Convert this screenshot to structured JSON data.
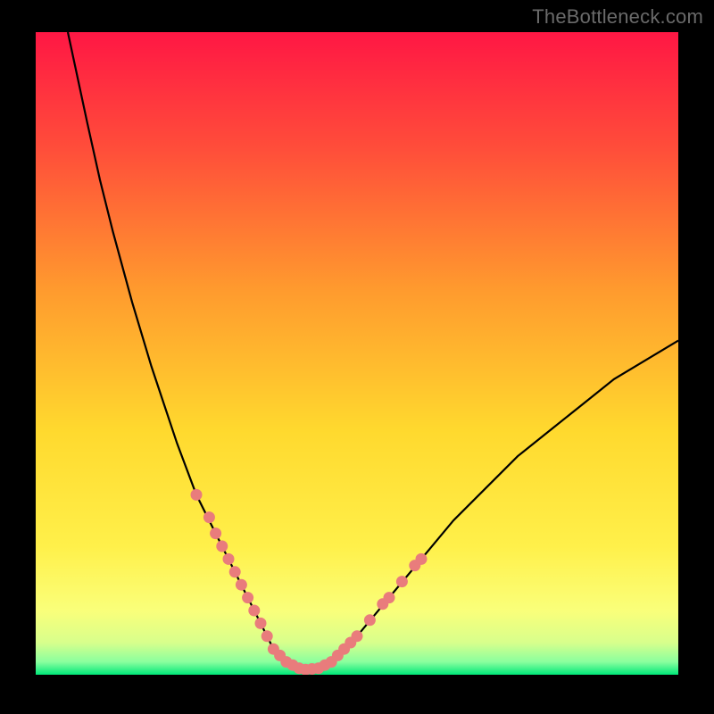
{
  "watermark": "TheBottleneck.com",
  "colors": {
    "gradient_stops": [
      {
        "offset": "0%",
        "color": "#ff1744"
      },
      {
        "offset": "18%",
        "color": "#ff4d3a"
      },
      {
        "offset": "40%",
        "color": "#ff9a2e"
      },
      {
        "offset": "62%",
        "color": "#ffd92e"
      },
      {
        "offset": "80%",
        "color": "#fff04a"
      },
      {
        "offset": "90%",
        "color": "#faff7a"
      },
      {
        "offset": "95%",
        "color": "#d8ff8c"
      },
      {
        "offset": "98%",
        "color": "#8aff9e"
      },
      {
        "offset": "100%",
        "color": "#00e879"
      }
    ],
    "curve": "#000000",
    "dot_fill": "#e97c7c",
    "dot_stroke": "#e97c7c"
  },
  "chart_data": {
    "type": "line",
    "title": "",
    "xlabel": "",
    "ylabel": "",
    "xlim": [
      0,
      100
    ],
    "ylim": [
      0,
      100
    ],
    "x": [
      5,
      8,
      10,
      12,
      15,
      18,
      20,
      22,
      25,
      28,
      30,
      32,
      33,
      34,
      35,
      36,
      37,
      38,
      39,
      40,
      41,
      42,
      44,
      46,
      48,
      50,
      55,
      60,
      65,
      70,
      75,
      80,
      85,
      90,
      95,
      100
    ],
    "y": [
      100,
      86,
      77,
      69,
      58,
      48,
      42,
      36,
      28,
      22,
      18,
      14,
      12,
      10,
      8,
      6,
      4,
      3,
      2,
      1.5,
      1,
      0.8,
      1,
      2,
      4,
      6,
      12,
      18,
      24,
      29,
      34,
      38,
      42,
      46,
      49,
      52
    ],
    "highlight_points": [
      {
        "x": 25,
        "y": 28
      },
      {
        "x": 27,
        "y": 24.5
      },
      {
        "x": 28,
        "y": 22
      },
      {
        "x": 29,
        "y": 20
      },
      {
        "x": 30,
        "y": 18
      },
      {
        "x": 31,
        "y": 16
      },
      {
        "x": 32,
        "y": 14
      },
      {
        "x": 33,
        "y": 12
      },
      {
        "x": 34,
        "y": 10
      },
      {
        "x": 35,
        "y": 8
      },
      {
        "x": 36,
        "y": 6
      },
      {
        "x": 37,
        "y": 4
      },
      {
        "x": 38,
        "y": 3
      },
      {
        "x": 39,
        "y": 2
      },
      {
        "x": 40,
        "y": 1.5
      },
      {
        "x": 41,
        "y": 1
      },
      {
        "x": 42,
        "y": 0.8
      },
      {
        "x": 43,
        "y": 0.9
      },
      {
        "x": 44,
        "y": 1
      },
      {
        "x": 45,
        "y": 1.5
      },
      {
        "x": 46,
        "y": 2
      },
      {
        "x": 47,
        "y": 3
      },
      {
        "x": 48,
        "y": 4
      },
      {
        "x": 49,
        "y": 5
      },
      {
        "x": 50,
        "y": 6
      },
      {
        "x": 52,
        "y": 8.5
      },
      {
        "x": 54,
        "y": 11
      },
      {
        "x": 55,
        "y": 12
      },
      {
        "x": 57,
        "y": 14.5
      },
      {
        "x": 59,
        "y": 17
      },
      {
        "x": 60,
        "y": 18
      }
    ]
  }
}
